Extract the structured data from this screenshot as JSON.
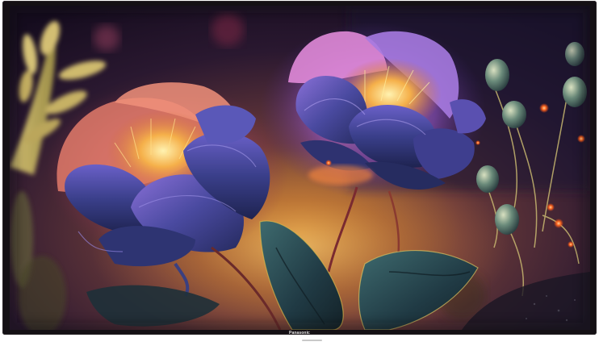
{
  "device": {
    "brand_label": "Panasonic"
  },
  "screen_image": {
    "subject": "glowing-peony-flowers",
    "colors": {
      "background_dark": "#1f1026",
      "glow_warm": "#e9a74a",
      "petal_blue": "#3b3f86",
      "petal_violet": "#7b4fc0",
      "petal_pink": "#e07a88",
      "leaf_teal": "#23404a",
      "foliage_yellow": "#d8c26a",
      "light_orange": "#ff7a2a"
    }
  }
}
